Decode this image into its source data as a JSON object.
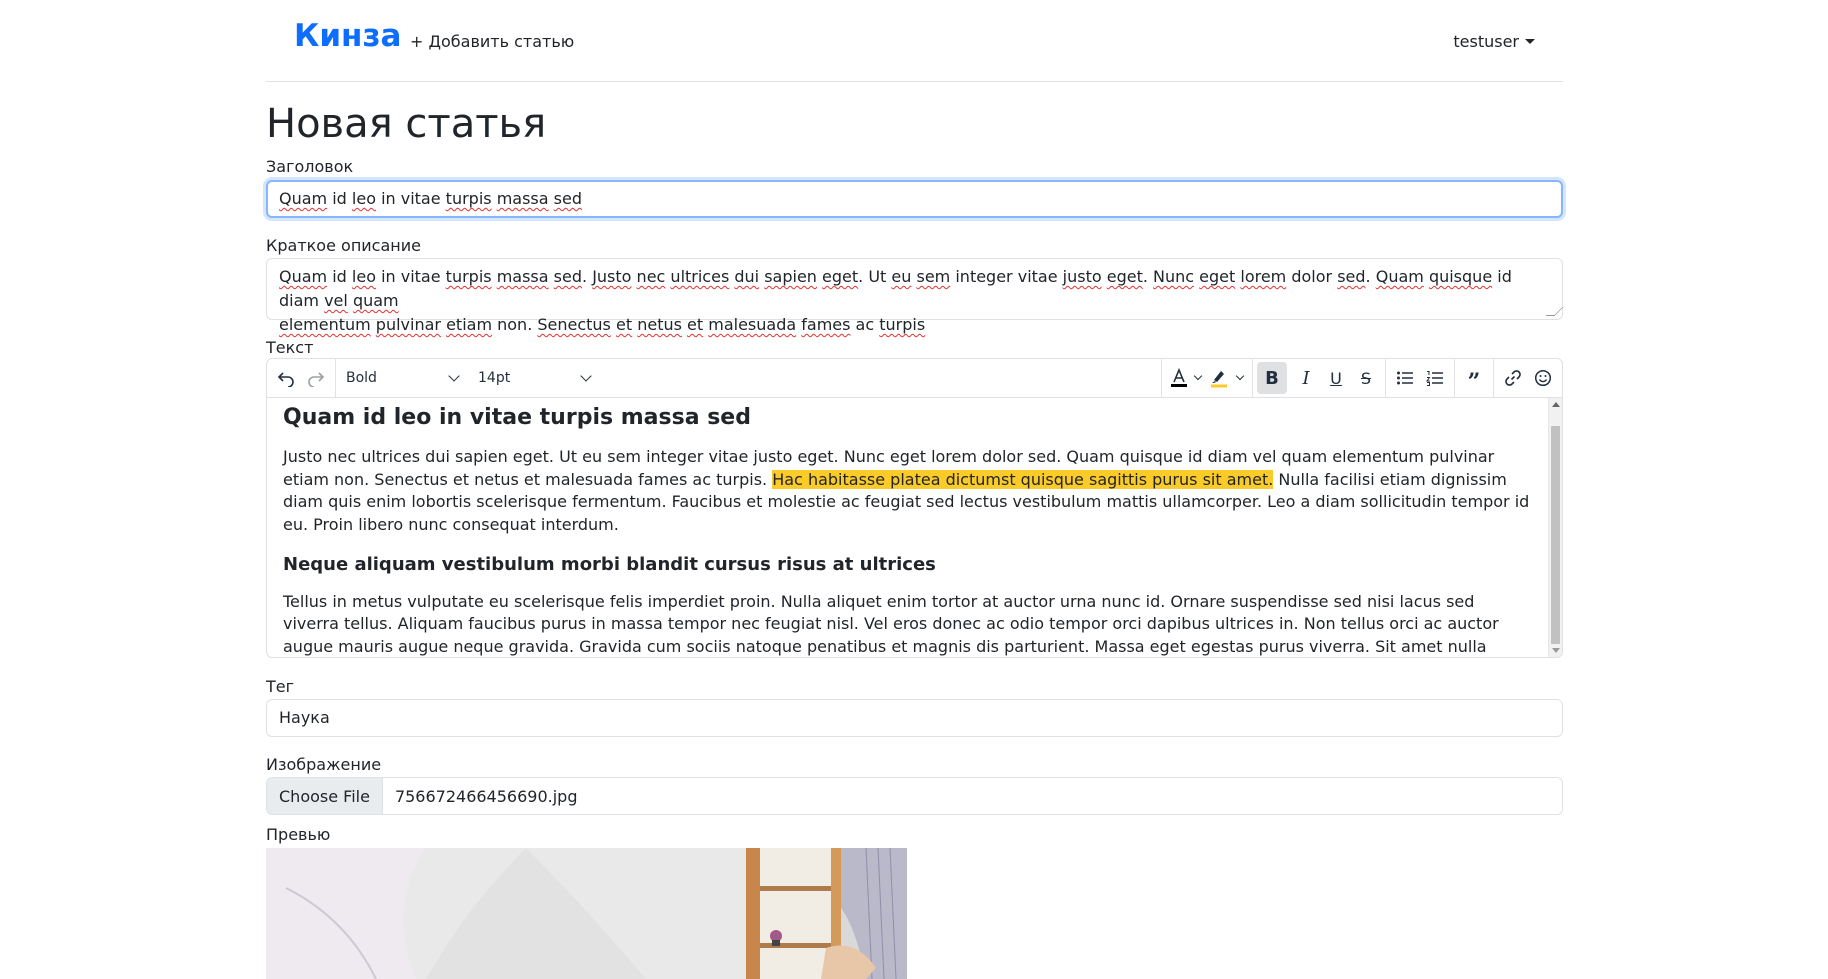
{
  "nav": {
    "brand": "Кинза",
    "add_article": "+ Добавить статью",
    "user": "testuser"
  },
  "page": {
    "title": "Новая статья"
  },
  "form": {
    "title_label": "Заголовок",
    "title_words": [
      "Quam",
      " id ",
      "leo",
      " in vitae ",
      "turpis",
      " ",
      "massa",
      " ",
      "sed"
    ],
    "summary_label": "Краткое описание",
    "summary_line1": [
      "Quam",
      " id ",
      "leo",
      " in vitae ",
      "turpis",
      " ",
      "massa",
      " ",
      "sed",
      ". ",
      "Justo",
      " ",
      "nec",
      " ",
      "ultrices",
      " ",
      "dui",
      " ",
      "sapien",
      " ",
      "eget",
      ". Ut ",
      "eu",
      " ",
      "sem",
      " integer vitae ",
      "justo",
      " ",
      "eget",
      ". ",
      "Nunc",
      " ",
      "eget",
      " ",
      "lorem",
      " dolor ",
      "sed",
      ". ",
      "Quam",
      " ",
      "quisque",
      " id diam ",
      "vel",
      " ",
      "quam"
    ],
    "summary_line2": [
      "elementum",
      " ",
      "pulvinar",
      " ",
      "etiam",
      " non. ",
      "Senectus",
      " ",
      "et",
      " ",
      "netus",
      " ",
      "et",
      " ",
      "malesuada",
      " ",
      "fames",
      " ac ",
      "turpis"
    ],
    "text_label": "Текст",
    "tag_label": "Тег",
    "tag_value": "Наука",
    "image_label": "Изображение",
    "choose_file": "Choose File",
    "file_name": "756672466456690.jpg",
    "preview_label": "Превью"
  },
  "editor": {
    "block_format": "Bold",
    "font_size": "14pt",
    "heading1": "Quam id leo in vitae turpis massa sed",
    "para1_a": "Justo nec ultrices dui sapien eget. Ut eu sem integer vitae justo eget. Nunc eget lorem dolor sed. Quam quisque id diam vel quam elementum pulvinar etiam non. Senectus et netus et malesuada fames ac turpis. ",
    "para1_highlight": "Hac habitasse platea dictumst quisque sagittis purus sit amet.",
    "para1_b": " Nulla facilisi etiam dignissim diam quis enim lobortis scelerisque fermentum. Faucibus et molestie ac feugiat sed lectus vestibulum mattis ullamcorper. Leo a diam sollicitudin tempor id eu. Proin libero nunc consequat interdum.",
    "heading2": "Neque aliquam vestibulum morbi blandit cursus risus at ultrices",
    "para2": "Tellus in metus vulputate eu scelerisque felis imperdiet proin. Nulla aliquet enim tortor at auctor urna nunc id. Ornare suspendisse sed nisi lacus sed viverra tellus. Aliquam faucibus purus in massa tempor nec feugiat nisl. Vel eros donec ac odio tempor orci dapibus ultrices in. Non tellus orci ac auctor augue mauris augue neque gravida. Gravida cum sociis natoque penatibus et magnis dis parturient. Massa eget egestas purus viverra. Sit amet nulla facilisi morbi.",
    "highlight_color": "#fbcb29",
    "text_color": "#000000"
  },
  "icons": [
    "undo-icon",
    "redo-icon",
    "text-color-icon",
    "highlight-icon",
    "bold-icon",
    "italic-icon",
    "underline-icon",
    "strikethrough-icon",
    "bullet-list-icon",
    "numbered-list-icon",
    "blockquote-icon",
    "link-icon",
    "emoji-icon"
  ],
  "colors": {
    "brand": "#0d6efd",
    "focus_border": "#86b7fe"
  }
}
